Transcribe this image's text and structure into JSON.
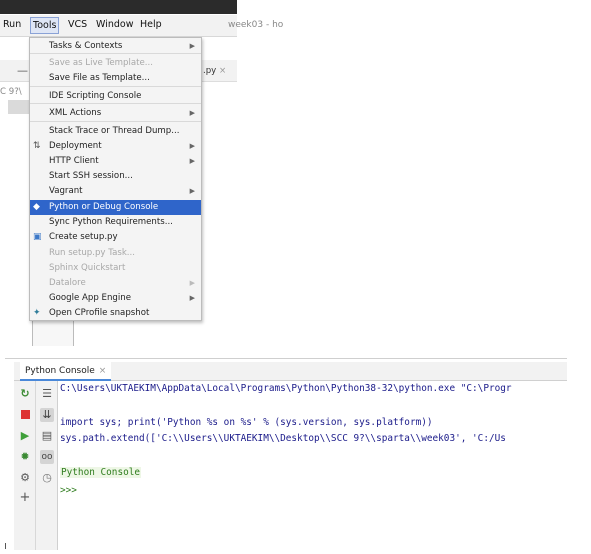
{
  "menubar": {
    "items": [
      {
        "label": "Run"
      },
      {
        "label": "Tools"
      },
      {
        "label": "VCS"
      },
      {
        "label": "Window"
      },
      {
        "label": "Help"
      }
    ],
    "title_fragment": "week03 - ho"
  },
  "editor": {
    "tab_fragment": ".py",
    "path_fragment": "C 9?\\"
  },
  "tools_menu": {
    "items": [
      {
        "label": "Tasks & Contexts",
        "submenu": true,
        "enabled": true
      },
      {
        "label": "Save as Live Template...",
        "submenu": false,
        "enabled": false
      },
      {
        "label": "Save File as Template...",
        "submenu": false,
        "enabled": true
      },
      {
        "label": "IDE Scripting Console",
        "submenu": false,
        "enabled": true
      },
      {
        "label": "XML Actions",
        "submenu": true,
        "enabled": true
      },
      {
        "label": "Stack Trace or Thread Dump...",
        "submenu": false,
        "enabled": true
      },
      {
        "label": "Deployment",
        "submenu": true,
        "enabled": true,
        "icon": "deployment-icon"
      },
      {
        "label": "HTTP Client",
        "submenu": true,
        "enabled": true
      },
      {
        "label": "Start SSH session...",
        "submenu": false,
        "enabled": true
      },
      {
        "label": "Vagrant",
        "submenu": true,
        "enabled": true
      },
      {
        "label": "Python or Debug Console",
        "submenu": false,
        "enabled": true,
        "selected": true,
        "icon": "python-icon"
      },
      {
        "label": "Sync Python Requirements...",
        "submenu": false,
        "enabled": true
      },
      {
        "label": "Create setup.py",
        "submenu": false,
        "enabled": true,
        "icon": "setup-py-icon"
      },
      {
        "label": "Run setup.py Task...",
        "submenu": false,
        "enabled": false
      },
      {
        "label": "Sphinx Quickstart",
        "submenu": false,
        "enabled": false
      },
      {
        "label": "Datalore",
        "submenu": true,
        "enabled": false
      },
      {
        "label": "Google App Engine",
        "submenu": true,
        "enabled": true
      },
      {
        "label": "Open CProfile snapshot",
        "submenu": false,
        "enabled": true,
        "icon": "cprofile-icon"
      }
    ]
  },
  "console": {
    "tab_label": "Python Console",
    "close_glyph": "×",
    "lines": [
      "C:\\Users\\UKTAEKIM\\AppData\\Local\\Programs\\Python\\Python38-32\\python.exe \"C:\\Progr",
      "",
      "import sys; print('Python %s on %s' % (sys.version, sys.platform))",
      "sys.path.extend(['C:\\\\Users\\\\UKTAEKIM\\\\Desktop\\\\SCC 9?\\\\sparta\\\\week03', 'C:/Us",
      "",
      "Python Console",
      ">>>"
    ],
    "toolbar_left": [
      "rerun-icon",
      "stop-icon",
      "run-icon",
      "debug-icon",
      "settings-icon",
      "add-icon"
    ],
    "toolbar_right": [
      "soft-wrap-icon",
      "scroll-to-end-icon",
      "print-icon",
      "show-variables-icon",
      "history-icon"
    ]
  },
  "colors": {
    "selection": "#2f65ca",
    "console_text": "#1b1b8a",
    "console_green": "#2f7d1e",
    "ide_dark": "#2b2b2b"
  }
}
